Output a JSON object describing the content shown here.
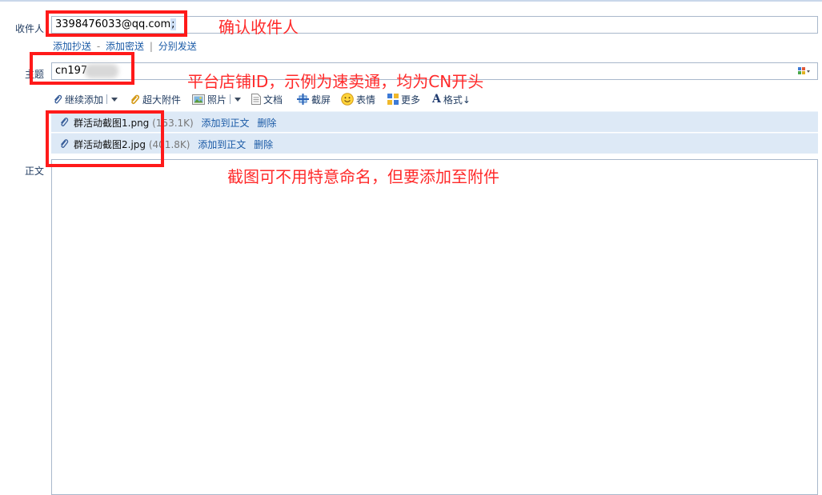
{
  "labels": {
    "recipient": "收件人",
    "subject": "主题",
    "body": "正文"
  },
  "recipient": {
    "value": "3398476033@qq.com",
    "separator": ";"
  },
  "recipient_links": {
    "cc": "添加抄送",
    "dash": "-",
    "bcc": "添加密送",
    "pipe": "|",
    "separate": "分别发送"
  },
  "subject": {
    "value": "cn197"
  },
  "toolbar": {
    "continue_add": "继续添加",
    "large_attachment": "超大附件",
    "photo": "照片",
    "document": "文档",
    "screenshot": "截屏",
    "emoji": "表情",
    "more": "更多",
    "format": "格式↓"
  },
  "attachments": [
    {
      "name": "群活动截图1.png",
      "size": "(153.1K)",
      "add_to_body": "添加到正文",
      "delete": "删除"
    },
    {
      "name": "群活动截图2.jpg",
      "size": "(401.8K)",
      "add_to_body": "添加到正文",
      "delete": "删除"
    }
  ],
  "annotations": {
    "recipient_note": "确认收件人",
    "subject_note": "平台店铺ID，示例为速卖通，均为CN开头",
    "attachment_note": "截图可不用特意命名，但要添加至附件"
  },
  "colors": {
    "annotation_red": "#ff2a2a",
    "link_blue": "#1a5aa6",
    "attachment_bg": "#dde9f6"
  }
}
